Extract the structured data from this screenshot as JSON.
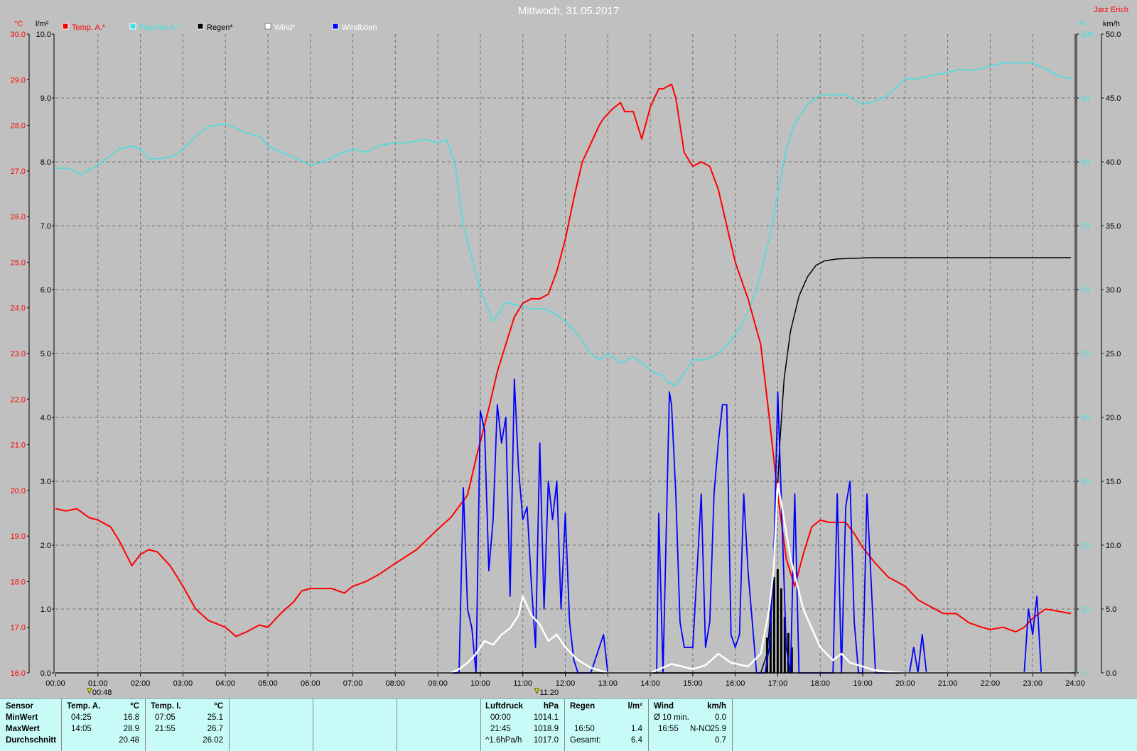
{
  "chart_data": {
    "type": "line",
    "title": "Mittwoch, 31.05.2017",
    "author": "Jarz Erich",
    "x_ticks": [
      "00:00",
      "01:00",
      "02:00",
      "03:00",
      "04:00",
      "05:00",
      "06:00",
      "07:00",
      "08:00",
      "09:00",
      "10:00",
      "11:00",
      "12:00",
      "13:00",
      "14:00",
      "15:00",
      "16:00",
      "17:00",
      "18:00",
      "19:00",
      "20:00",
      "21:00",
      "22:00",
      "23:00",
      "24:00"
    ],
    "x_markers": [
      {
        "x": 0.8,
        "label": "00:48"
      },
      {
        "x": 11.33,
        "label": "11:20"
      }
    ],
    "axes": {
      "temp": {
        "unit": "°C",
        "min": 16,
        "max": 30,
        "ticks": [
          "16.0",
          "17.0",
          "18.0",
          "19.0",
          "20.0",
          "21.0",
          "22.0",
          "23.0",
          "24.0",
          "25.0",
          "26.0",
          "27.0",
          "28.0",
          "29.0",
          "30.0"
        ]
      },
      "rain": {
        "unit": "l/m²",
        "min": 0,
        "max": 10,
        "ticks": [
          "0.0",
          "1.0",
          "2.0",
          "3.0",
          "4.0",
          "5.0",
          "6.0",
          "7.0",
          "8.0",
          "9.0",
          "10.0"
        ]
      },
      "humidity": {
        "unit": "%",
        "min": 0,
        "max": 100,
        "ticks": [
          "0",
          "10",
          "20",
          "30",
          "40",
          "50",
          "60",
          "70",
          "80",
          "90",
          "100"
        ]
      },
      "wind": {
        "unit": "km/h",
        "min": 0,
        "max": 50,
        "ticks": [
          "0.0",
          "5.0",
          "10.0",
          "15.0",
          "20.0",
          "25.0",
          "30.0",
          "35.0",
          "40.0",
          "45.0",
          "50.0"
        ]
      }
    },
    "legend": [
      "Temp. A.*",
      "Feuchte A.*",
      "Regen*",
      "Wind*",
      "Windböen"
    ],
    "colors": {
      "temp": "#ff0000",
      "humidity": "#40e0e0",
      "rain": "#000000",
      "wind": "#ffffff",
      "gust": "#0000ff"
    },
    "series": [
      {
        "name": "Temp. A.*",
        "axis": "temp",
        "x": [
          0,
          0.25,
          0.5,
          0.8,
          1.0,
          1.3,
          1.5,
          1.8,
          2.0,
          2.2,
          2.4,
          2.7,
          3.0,
          3.3,
          3.6,
          4.0,
          4.25,
          4.5,
          4.8,
          5.0,
          5.3,
          5.6,
          5.8,
          6.0,
          6.5,
          6.8,
          7.0,
          7.3,
          7.6,
          8.0,
          8.5,
          9.0,
          9.3,
          9.5,
          9.7,
          9.9,
          10.2,
          10.4,
          10.6,
          10.8,
          11.0,
          11.2,
          11.4,
          11.6,
          11.8,
          12.0,
          12.2,
          12.4,
          12.6,
          12.8,
          12.9,
          13.0,
          13.1,
          13.3,
          13.4,
          13.6,
          13.8,
          14.0,
          14.2,
          14.3,
          14.5,
          14.6,
          14.8,
          15.0,
          15.2,
          15.4,
          15.6,
          15.8,
          16.0,
          16.3,
          16.6,
          16.8,
          17.0,
          17.2,
          17.4,
          17.6,
          17.8,
          18.0,
          18.2,
          18.4,
          18.6,
          18.8,
          19.0,
          19.3,
          19.6,
          20.0,
          20.3,
          20.6,
          20.9,
          21.2,
          21.5,
          21.8,
          22.0,
          22.3,
          22.6,
          22.8,
          23.0,
          23.3,
          23.6,
          23.9
        ],
        "y": [
          19.6,
          19.55,
          19.6,
          19.4,
          19.35,
          19.2,
          18.9,
          18.35,
          18.6,
          18.7,
          18.65,
          18.35,
          17.9,
          17.4,
          17.15,
          17.0,
          16.8,
          16.9,
          17.05,
          17.0,
          17.3,
          17.55,
          17.8,
          17.85,
          17.85,
          17.75,
          17.9,
          18.0,
          18.15,
          18.4,
          18.7,
          19.15,
          19.4,
          19.65,
          19.9,
          20.7,
          21.8,
          22.6,
          23.2,
          23.8,
          24.1,
          24.2,
          24.2,
          24.3,
          24.8,
          25.5,
          26.4,
          27.2,
          27.6,
          28.0,
          28.15,
          28.25,
          28.35,
          28.5,
          28.3,
          28.3,
          27.7,
          28.4,
          28.8,
          28.8,
          28.9,
          28.6,
          27.4,
          27.1,
          27.2,
          27.1,
          26.6,
          25.8,
          25.0,
          24.2,
          23.2,
          21.6,
          19.9,
          18.5,
          17.9,
          18.6,
          19.2,
          19.35,
          19.3,
          19.3,
          19.3,
          19.05,
          18.75,
          18.4,
          18.1,
          17.9,
          17.6,
          17.45,
          17.3,
          17.3,
          17.1,
          17.0,
          16.95,
          17.0,
          16.9,
          17.0,
          17.2,
          17.4,
          17.35,
          17.3
        ]
      },
      {
        "name": "Feuchte A.*",
        "axis": "humidity",
        "x": [
          0,
          0.3,
          0.6,
          1.0,
          1.5,
          1.8,
          2.0,
          2.2,
          2.5,
          2.8,
          3.0,
          3.3,
          3.6,
          4.0,
          4.5,
          4.8,
          5.0,
          5.5,
          6.0,
          6.3,
          6.6,
          7.0,
          7.3,
          7.6,
          8.0,
          8.3,
          8.7,
          9.0,
          9.2,
          9.4,
          9.5,
          9.6,
          9.8,
          10.0,
          10.3,
          10.6,
          10.9,
          11.2,
          11.5,
          11.8,
          12.0,
          12.3,
          12.6,
          12.8,
          13.0,
          13.3,
          13.6,
          13.9,
          14.1,
          14.3,
          14.4,
          14.6,
          14.8,
          15.0,
          15.3,
          15.6,
          15.9,
          16.2,
          16.5,
          16.8,
          17.0,
          17.2,
          17.4,
          17.7,
          18.0,
          18.3,
          18.6,
          19.0,
          19.3,
          19.6,
          20.0,
          20.3,
          20.6,
          21.0,
          21.3,
          21.6,
          22.0,
          22.3,
          22.6,
          23.0,
          23.3,
          23.6,
          23.9
        ],
        "y": [
          79,
          79,
          78,
          79.5,
          82,
          82.5,
          82,
          80.5,
          80.5,
          81,
          82,
          84,
          85.5,
          86,
          84.5,
          84,
          82.5,
          81,
          79.5,
          80,
          81,
          82,
          81.5,
          82.5,
          83,
          83,
          83.5,
          83,
          83.5,
          80,
          75,
          70,
          65,
          60,
          55,
          58,
          57.5,
          57,
          57,
          56,
          55,
          53,
          50,
          49,
          50,
          48.5,
          49.5,
          48,
          47,
          46.5,
          45.5,
          45,
          47,
          49,
          49,
          50,
          52,
          55,
          60,
          68,
          75,
          82,
          86,
          89,
          90.5,
          90.5,
          90.5,
          89,
          89.5,
          90.5,
          93,
          93,
          93.5,
          94,
          94.5,
          94.3,
          95,
          95.5,
          95.5,
          95.5,
          94.5,
          93.5,
          93
        ]
      },
      {
        "name": "Regen*",
        "axis": "rain",
        "x": [
          0,
          16.6,
          16.75,
          16.85,
          16.95,
          17.05,
          17.15,
          17.3,
          17.5,
          17.7,
          17.9,
          18.1,
          18.4,
          18.8,
          19.2,
          20.0,
          23.9
        ],
        "y": [
          0,
          0,
          0.3,
          1.1,
          2.3,
          3.6,
          4.6,
          5.35,
          5.9,
          6.2,
          6.38,
          6.45,
          6.48,
          6.49,
          6.5,
          6.5,
          6.5
        ]
      },
      {
        "name": "Wind*",
        "axis": "wind",
        "x": [
          0,
          9.3,
          9.5,
          9.7,
          9.9,
          10.1,
          10.3,
          10.5,
          10.7,
          10.9,
          11.0,
          11.2,
          11.4,
          11.6,
          11.8,
          12.0,
          12.3,
          12.6,
          13.0,
          14.0,
          14.5,
          15.0,
          15.3,
          15.6,
          15.9,
          16.3,
          16.6,
          16.8,
          16.9,
          17.0,
          17.1,
          17.3,
          17.6,
          18.0,
          18.3,
          18.5,
          18.7,
          19.0,
          19.3,
          19.6,
          20.0,
          23.9
        ],
        "y": [
          0,
          0,
          0.3,
          0.8,
          1.5,
          2.5,
          2.2,
          3.0,
          3.5,
          4.5,
          6.0,
          4.5,
          3.8,
          2.5,
          3.0,
          2.0,
          1.0,
          0.4,
          0,
          0,
          0.7,
          0.3,
          0.6,
          1.5,
          0.8,
          0.5,
          1.5,
          5.0,
          8.0,
          14.8,
          13.0,
          9.0,
          5.0,
          2.0,
          1.0,
          1.5,
          0.8,
          0.5,
          0.2,
          0.1,
          0,
          0
        ]
      },
      {
        "name": "Windböen",
        "axis": "wind",
        "x": [
          0,
          9.5,
          9.6,
          9.7,
          9.8,
          9.9,
          10.0,
          10.1,
          10.2,
          10.3,
          10.4,
          10.5,
          10.6,
          10.7,
          10.8,
          10.9,
          11.0,
          11.1,
          11.2,
          11.3,
          11.4,
          11.5,
          11.6,
          11.7,
          11.8,
          11.9,
          12.0,
          12.1,
          12.2,
          12.3,
          12.4,
          12.6,
          12.8,
          12.9,
          13.0,
          14.1,
          14.15,
          14.2,
          14.3,
          14.45,
          14.5,
          14.6,
          14.7,
          14.8,
          15.0,
          15.1,
          15.2,
          15.3,
          15.4,
          15.5,
          15.6,
          15.7,
          15.8,
          15.9,
          16.0,
          16.1,
          16.2,
          16.3,
          16.4,
          16.5,
          16.6,
          16.7,
          16.8,
          16.9,
          17.0,
          17.1,
          17.2,
          17.3,
          17.4,
          17.5,
          18.0,
          18.3,
          18.4,
          18.5,
          18.6,
          18.7,
          18.8,
          18.9,
          19.0,
          19.1,
          19.3,
          19.5,
          19.7,
          20.0,
          20.1,
          20.2,
          20.3,
          20.4,
          20.5,
          21.0,
          21.3,
          21.4,
          21.5,
          22.0,
          22.8,
          22.9,
          23.0,
          23.1,
          23.2,
          23.5,
          23.9
        ],
        "y": [
          0,
          0,
          14.5,
          5,
          3.5,
          0,
          20.5,
          19,
          8,
          12,
          21,
          18,
          20,
          6,
          23,
          16,
          12,
          13,
          7,
          2,
          18,
          5,
          15,
          12,
          15,
          5,
          12.5,
          4,
          1,
          0,
          0,
          0,
          2,
          3,
          0,
          0,
          0,
          12.5,
          0,
          22,
          21,
          14,
          4,
          2,
          2,
          8,
          14,
          2,
          4,
          14,
          18,
          21,
          21,
          3,
          2,
          3,
          14,
          8,
          4,
          0,
          0,
          0,
          2,
          8,
          22,
          12,
          2,
          0,
          14,
          0,
          0,
          0,
          14,
          0,
          13,
          15,
          4,
          0,
          0,
          14,
          0,
          0,
          0,
          0,
          0,
          2,
          0,
          3,
          0,
          0,
          0,
          0,
          0,
          0,
          0,
          5,
          3,
          6,
          0,
          0,
          0
        ]
      }
    ]
  },
  "stats": {
    "sensor": {
      "title": "Sensor",
      "rows": [
        "MinWert",
        "MaxWert",
        "Durchschnitt"
      ]
    },
    "temp_a": {
      "title": "Temp. A.",
      "unit": "°C",
      "min_time": "04:25",
      "min": "16.8",
      "max_time": "14:05",
      "max": "28.9",
      "avg": "20.48"
    },
    "temp_i": {
      "title": "Temp. I.",
      "unit": "°C",
      "min_time": "07:05",
      "min": "25.1",
      "max_time": "21:55",
      "max": "26.7",
      "avg": "26.02"
    },
    "luftdruck": {
      "title": "Luftdruck",
      "unit": "hPa",
      "min_time": "00:00",
      "min": "1014.1",
      "max_time": "21:45",
      "max": "1018.9",
      "trend": "^1.6hPa/h",
      "avg": "1017.0"
    },
    "regen": {
      "title": "Regen",
      "unit": "l/m²",
      "max_time": "16:50",
      "max": "1.4",
      "total_label": "Gesamt:",
      "total": "6.4"
    },
    "wind": {
      "title": "Wind",
      "unit": "km/h",
      "min_label": "Ø 10 min.",
      "min": "0.0",
      "max_time": "16:55",
      "max_dir": "N-NO",
      "max": "25.9",
      "avg": "0.7"
    }
  }
}
